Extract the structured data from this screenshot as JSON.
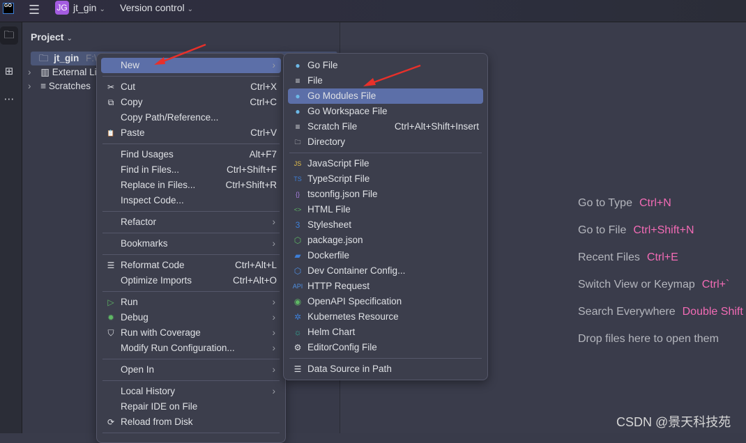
{
  "titlebar": {
    "logo": "GO",
    "project_badge": "JG",
    "project_name": "jt_gin",
    "vcs": "Version control"
  },
  "panel": {
    "title": "Project",
    "tree": [
      {
        "label": "jt_gin",
        "path": "F:\\g",
        "icon": "folder-icon"
      },
      {
        "label": "External Li",
        "icon": "library-icon"
      },
      {
        "label": "Scratches",
        "icon": "scratch-icon"
      }
    ]
  },
  "context_menu": [
    {
      "label": "New",
      "submenu": true,
      "selected": true
    },
    {
      "sep": true
    },
    {
      "label": "Cut",
      "shortcut": "Ctrl+X",
      "icon": "scissors-icon",
      "glyph": "✂"
    },
    {
      "label": "Copy",
      "shortcut": "Ctrl+C",
      "icon": "copy-icon",
      "glyph": "⧉"
    },
    {
      "label": "Copy Path/Reference..."
    },
    {
      "label": "Paste",
      "shortcut": "Ctrl+V",
      "icon": "paste-icon",
      "glyph": "📋"
    },
    {
      "sep": true
    },
    {
      "label": "Find Usages",
      "shortcut": "Alt+F7"
    },
    {
      "label": "Find in Files...",
      "shortcut": "Ctrl+Shift+F"
    },
    {
      "label": "Replace in Files...",
      "shortcut": "Ctrl+Shift+R"
    },
    {
      "label": "Inspect Code..."
    },
    {
      "sep": true
    },
    {
      "label": "Refactor",
      "submenu": true
    },
    {
      "sep": true
    },
    {
      "label": "Bookmarks",
      "submenu": true
    },
    {
      "sep": true
    },
    {
      "label": "Reformat Code",
      "shortcut": "Ctrl+Alt+L",
      "icon": "reformat-icon",
      "glyph": "☰"
    },
    {
      "label": "Optimize Imports",
      "shortcut": "Ctrl+Alt+O"
    },
    {
      "sep": true
    },
    {
      "label": "Run",
      "submenu": true,
      "icon": "run-icon",
      "glyph": "▷",
      "color": "#5fb865"
    },
    {
      "label": "Debug",
      "submenu": true,
      "icon": "debug-icon",
      "glyph": "✹",
      "color": "#5fb865"
    },
    {
      "label": "Run with Coverage",
      "submenu": true,
      "icon": "coverage-icon",
      "glyph": "⛉"
    },
    {
      "label": "Modify Run Configuration...",
      "submenu": true
    },
    {
      "sep": true
    },
    {
      "label": "Open In",
      "submenu": true
    },
    {
      "sep": true
    },
    {
      "label": "Local History",
      "submenu": true
    },
    {
      "label": "Repair IDE on File"
    },
    {
      "label": "Reload from Disk",
      "icon": "reload-icon",
      "glyph": "⟳"
    },
    {
      "sep": true
    }
  ],
  "new_submenu": [
    {
      "label": "Go File",
      "icon": "gopher-icon",
      "glyph": "●",
      "color": "#6cb8e6"
    },
    {
      "label": "File",
      "icon": "file-icon",
      "glyph": "≡"
    },
    {
      "label": "Go Modules File",
      "icon": "go-mod-icon",
      "glyph": "●",
      "color": "#6cb8e6",
      "selected": true
    },
    {
      "label": "Go Workspace File",
      "icon": "go-work-icon",
      "glyph": "●",
      "color": "#6cb8e6"
    },
    {
      "label": "Scratch File",
      "shortcut": "Ctrl+Alt+Shift+Insert",
      "icon": "scratch-icon",
      "glyph": "≡"
    },
    {
      "label": "Directory",
      "icon": "folder-icon",
      "glyph": "🗀"
    },
    {
      "sep": true
    },
    {
      "label": "JavaScript File",
      "icon": "js-icon",
      "glyph": "JS",
      "color": "#e6c14a"
    },
    {
      "label": "TypeScript File",
      "icon": "ts-icon",
      "glyph": "TS",
      "color": "#3d7fd8"
    },
    {
      "label": "tsconfig.json File",
      "icon": "braces-icon",
      "glyph": "{}",
      "color": "#a87fe0"
    },
    {
      "label": "HTML File",
      "icon": "html-icon",
      "glyph": "<>",
      "color": "#5fb865"
    },
    {
      "label": "Stylesheet",
      "icon": "css-icon",
      "glyph": "3",
      "color": "#3d7fd8"
    },
    {
      "label": "package.json",
      "icon": "nodejs-icon",
      "glyph": "⬡",
      "color": "#5fb865"
    },
    {
      "label": "Dockerfile",
      "icon": "docker-icon",
      "glyph": "▰",
      "color": "#3d7fd8"
    },
    {
      "label": "Dev Container Config...",
      "icon": "cube-icon",
      "glyph": "⬡",
      "color": "#4f8fe0"
    },
    {
      "label": "HTTP Request",
      "icon": "api-icon",
      "glyph": "API",
      "color": "#4f8fe0"
    },
    {
      "label": "OpenAPI Specification",
      "icon": "openapi-icon",
      "glyph": "◉",
      "color": "#5fb865"
    },
    {
      "label": "Kubernetes Resource",
      "icon": "kubernetes-icon",
      "glyph": "✲",
      "color": "#3d7fd8"
    },
    {
      "label": "Helm Chart",
      "icon": "helm-icon",
      "glyph": "☼",
      "color": "#2fb8a0"
    },
    {
      "label": "EditorConfig File",
      "icon": "gear-icon",
      "glyph": "⚙"
    },
    {
      "sep": true
    },
    {
      "label": "Data Source in Path",
      "icon": "database-icon",
      "glyph": "☰"
    }
  ],
  "editor_hints": [
    {
      "label": "Go to Type",
      "key": "Ctrl+N"
    },
    {
      "label": "Go to File",
      "key": "Ctrl+Shift+N"
    },
    {
      "label": "Recent Files",
      "key": "Ctrl+E"
    },
    {
      "label": "Switch View or Keymap",
      "key": "Ctrl+`"
    },
    {
      "label": "Search Everywhere",
      "key": "Double Shift"
    },
    {
      "label": "Drop files here to open them"
    }
  ],
  "watermark": "CSDN @景天科技苑",
  "colors": {
    "accent": "#5c6fa8",
    "shortcut_pink": "#f26bb5",
    "annotation_arrow": "#e8302a"
  }
}
